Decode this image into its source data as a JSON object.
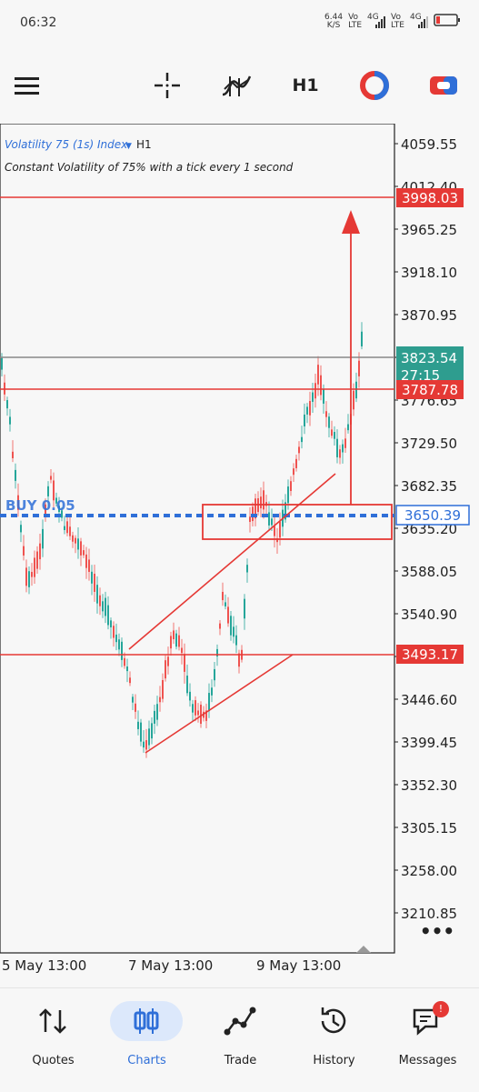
{
  "status_bar": {
    "time": "06:32",
    "net_speed": "6.44",
    "net_unit": "K/S",
    "sim1": "Vo\nLTE",
    "sim2": "Vo\nLTE",
    "sim1_gen": "4G",
    "sim2_gen": "4G"
  },
  "toolbar": {
    "menu_icon": "hamburger-icon",
    "crosshair_icon": "crosshair-icon",
    "indicators_icon": "indicators-icon",
    "timeframe_label": "H1",
    "color_theme_icon": "color-theme-icon",
    "trade_panel_icon": "trade-panel-icon"
  },
  "chart": {
    "symbol": "Volatility 75 (1s) Index",
    "timeframe": "H1",
    "description": "Constant Volatility of 75% with a tick every 1 second",
    "order_label": "BUY 0.05",
    "more_label": "•••",
    "price_axis_ticks": [
      "4059.55",
      "4012.40",
      "3965.25",
      "3918.10",
      "3870.95",
      "3823.54",
      "3776.65",
      "3729.50",
      "3682.35",
      "3635.20",
      "3588.05",
      "3540.90",
      "3493.17",
      "3446.60",
      "3399.45",
      "3352.30",
      "3305.15",
      "3258.00",
      "3210.85"
    ],
    "price_tags": {
      "target": "3998.03",
      "current": "3823.54",
      "countdown": "27:15",
      "resistance": "3787.78",
      "entry": "3650.39",
      "support": "3493.17"
    },
    "time_axis": [
      "5 May 13:00",
      "7 May 13:00",
      "9 May 13:00"
    ],
    "colors": {
      "bull": "#26a69a",
      "bear": "#ef5350",
      "annotation": "#e53935",
      "entry_line": "#2f6fd8",
      "current_tag": "#2e9d8f"
    }
  },
  "bottom_nav": {
    "items": [
      {
        "label": "Quotes",
        "icon": "quotes-icon"
      },
      {
        "label": "Charts",
        "icon": "charts-icon"
      },
      {
        "label": "Trade",
        "icon": "trade-icon"
      },
      {
        "label": "History",
        "icon": "history-icon"
      },
      {
        "label": "Messages",
        "icon": "messages-icon"
      }
    ],
    "messages_badge": "!"
  }
}
